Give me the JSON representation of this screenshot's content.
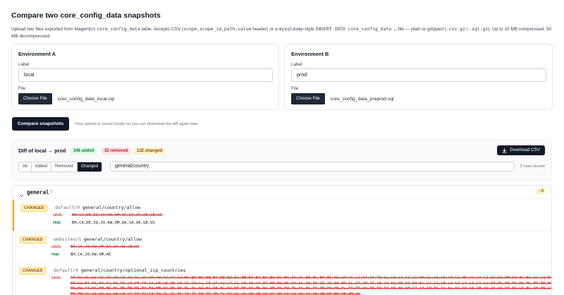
{
  "header": {
    "title": "Compare two core_config_data snapshots",
    "intro_1": "Upload two files exported from Magento's ",
    "intro_code_1": "core_config_data",
    "intro_2": " table. Accepts CSV (",
    "intro_code_2": "scope,scope_id,path,value",
    "intro_3": " header) or a ",
    "intro_code_3": "mysqldump",
    "intro_4": "-style ",
    "intro_code_4": "INSERT INTO core_config_data …",
    "intro_5": " file — plain or gzipped (",
    "intro_code_5": ".csv.gz",
    "intro_6": " / ",
    "intro_code_6": ".sql.gz",
    "intro_7": "). Up to 10 MB compressed, 50 MB decompressed."
  },
  "env_a": {
    "title": "Environment A",
    "label_caption": "Label",
    "label_value": "local",
    "file_caption": "File",
    "choose_label": "Choose File",
    "file_name": "core_config_data_local.sql"
  },
  "env_b": {
    "title": "Environment B",
    "label_caption": "Label",
    "label_value": "prod",
    "file_caption": "File",
    "choose_label": "Choose File",
    "file_name": "core_config_data_preprod.sql"
  },
  "actions": {
    "compare_label": "Compare snapshots",
    "compare_note": "Your upload is saved locally so you can download the diff again later."
  },
  "diff": {
    "title": "Diff of local → prod",
    "added": "346 added",
    "removed": "32 removed",
    "changed": "132 changed",
    "download_label": "Download CSV",
    "filters": [
      "All",
      "Added",
      "Removed",
      "Changed"
    ],
    "active_filter": "Changed",
    "filter_value": "general/country",
    "row_count": "3 rows shown"
  },
  "group": {
    "name": "general",
    "count": "3",
    "delta": "~3",
    "entries": [
      {
        "status": "CHANGED",
        "scope": "default/0",
        "path": "general/country/allow",
        "local_label": "LOCAL",
        "prod_label": "PROD",
        "local_value": "BH,CA,DE,IQ,JO,KW,OM,QA,SA,ZA,AE,GB,US",
        "prod_value": "BH,CA,DE,IQ,JO,KW,OM,QA,SA,AE,GB,US"
      },
      {
        "status": "CHANGED",
        "scope": "websites/1",
        "path": "general/country/allow",
        "local_label": "LOCAL",
        "prod_label": "PROD",
        "local_value": "BH,CA,JO,KW,OM,QA,ZA,AE,GB,US",
        "prod_value": "BH,CA,JO,KW,OM,AE"
      },
      {
        "status": "CHANGED",
        "scope": "default/0",
        "path": "general/country/optional_zip_countries",
        "local_label": "LOCAL",
        "local_value": "AF,AX,AL,DZ,AS,AD,AO,AI,AQ,AG,AR,AM,AW,AU,AT,AZ,BS,BH,BD,BB,BY,BE,BZ,BJ,BM,BT,BO,BA,BW,BV,BR,IO,VG,BN,BG,BF,BI,KH,CM,CA,CV,KY,CF,TD,CL,CN,CX,CC,CO,KM,CG,CD,CK,CR,CI,HR,CU,CY,CZ,DK,DJ,DM,DO,EC,EG,SV,GQ,ER,EE,SZ,ET,FK,FO,FJ,FI,FR,GF,PF,TF,GA,GM,GE,DE,GH,GI,GR,GL,GD,GP,GU,GT,GG,GN,GW,GY,HT,HM,HN,HK,HU,IS,IN,ID,IR,IQ,IE,IM,IL,IT,JM,JP,JE,JO,KZ,KE,KI,KW,KG,LA,LV,LB,LS,LR,LY,LI,LT,LU,MO,MG,MW,MY,MV,ML,MT,MH,MQ,MR,MU,YT,MX,FM,MD,MC,MN,ME,MS,MA,MZ,MM,NA,NR,NP,NL,NC,NZ,NI,NE,NG,NU,NF,MP,KP,MK,NO,OM,PK,PW,PS,PA,PG,PY,PE,PH,PN,PL,PT,PR,QA,RE,RO,RU,RW,WS,SM,ST,SA,SN,RS,SC,SL,SG,SK,SI,SB,SO,ZA,GS,KR,ES,LK,BL,SH,KN,LC,MF,PM,VC,SD,SR,SJ,SE,CH,SY,TW,TJ,TZ,TH,TL,TG,TK,TO,TT,TN,TR,TM,TC,TV,UG,UA,AE,GB,US,UY,UM,VI,UZ,VU,VA,VE,VN,WF,EH,YE,ZM,ZW"
      }
    ]
  },
  "colors": {
    "primary": "#111827",
    "added": "#15803d",
    "removed": "#dc2626",
    "changed": "#92400e",
    "changed_bg": "#fef3c7",
    "highlight_border": "#f59e0b"
  },
  "icons": {
    "download": "download-icon",
    "chevron": "chevron-down-icon"
  }
}
